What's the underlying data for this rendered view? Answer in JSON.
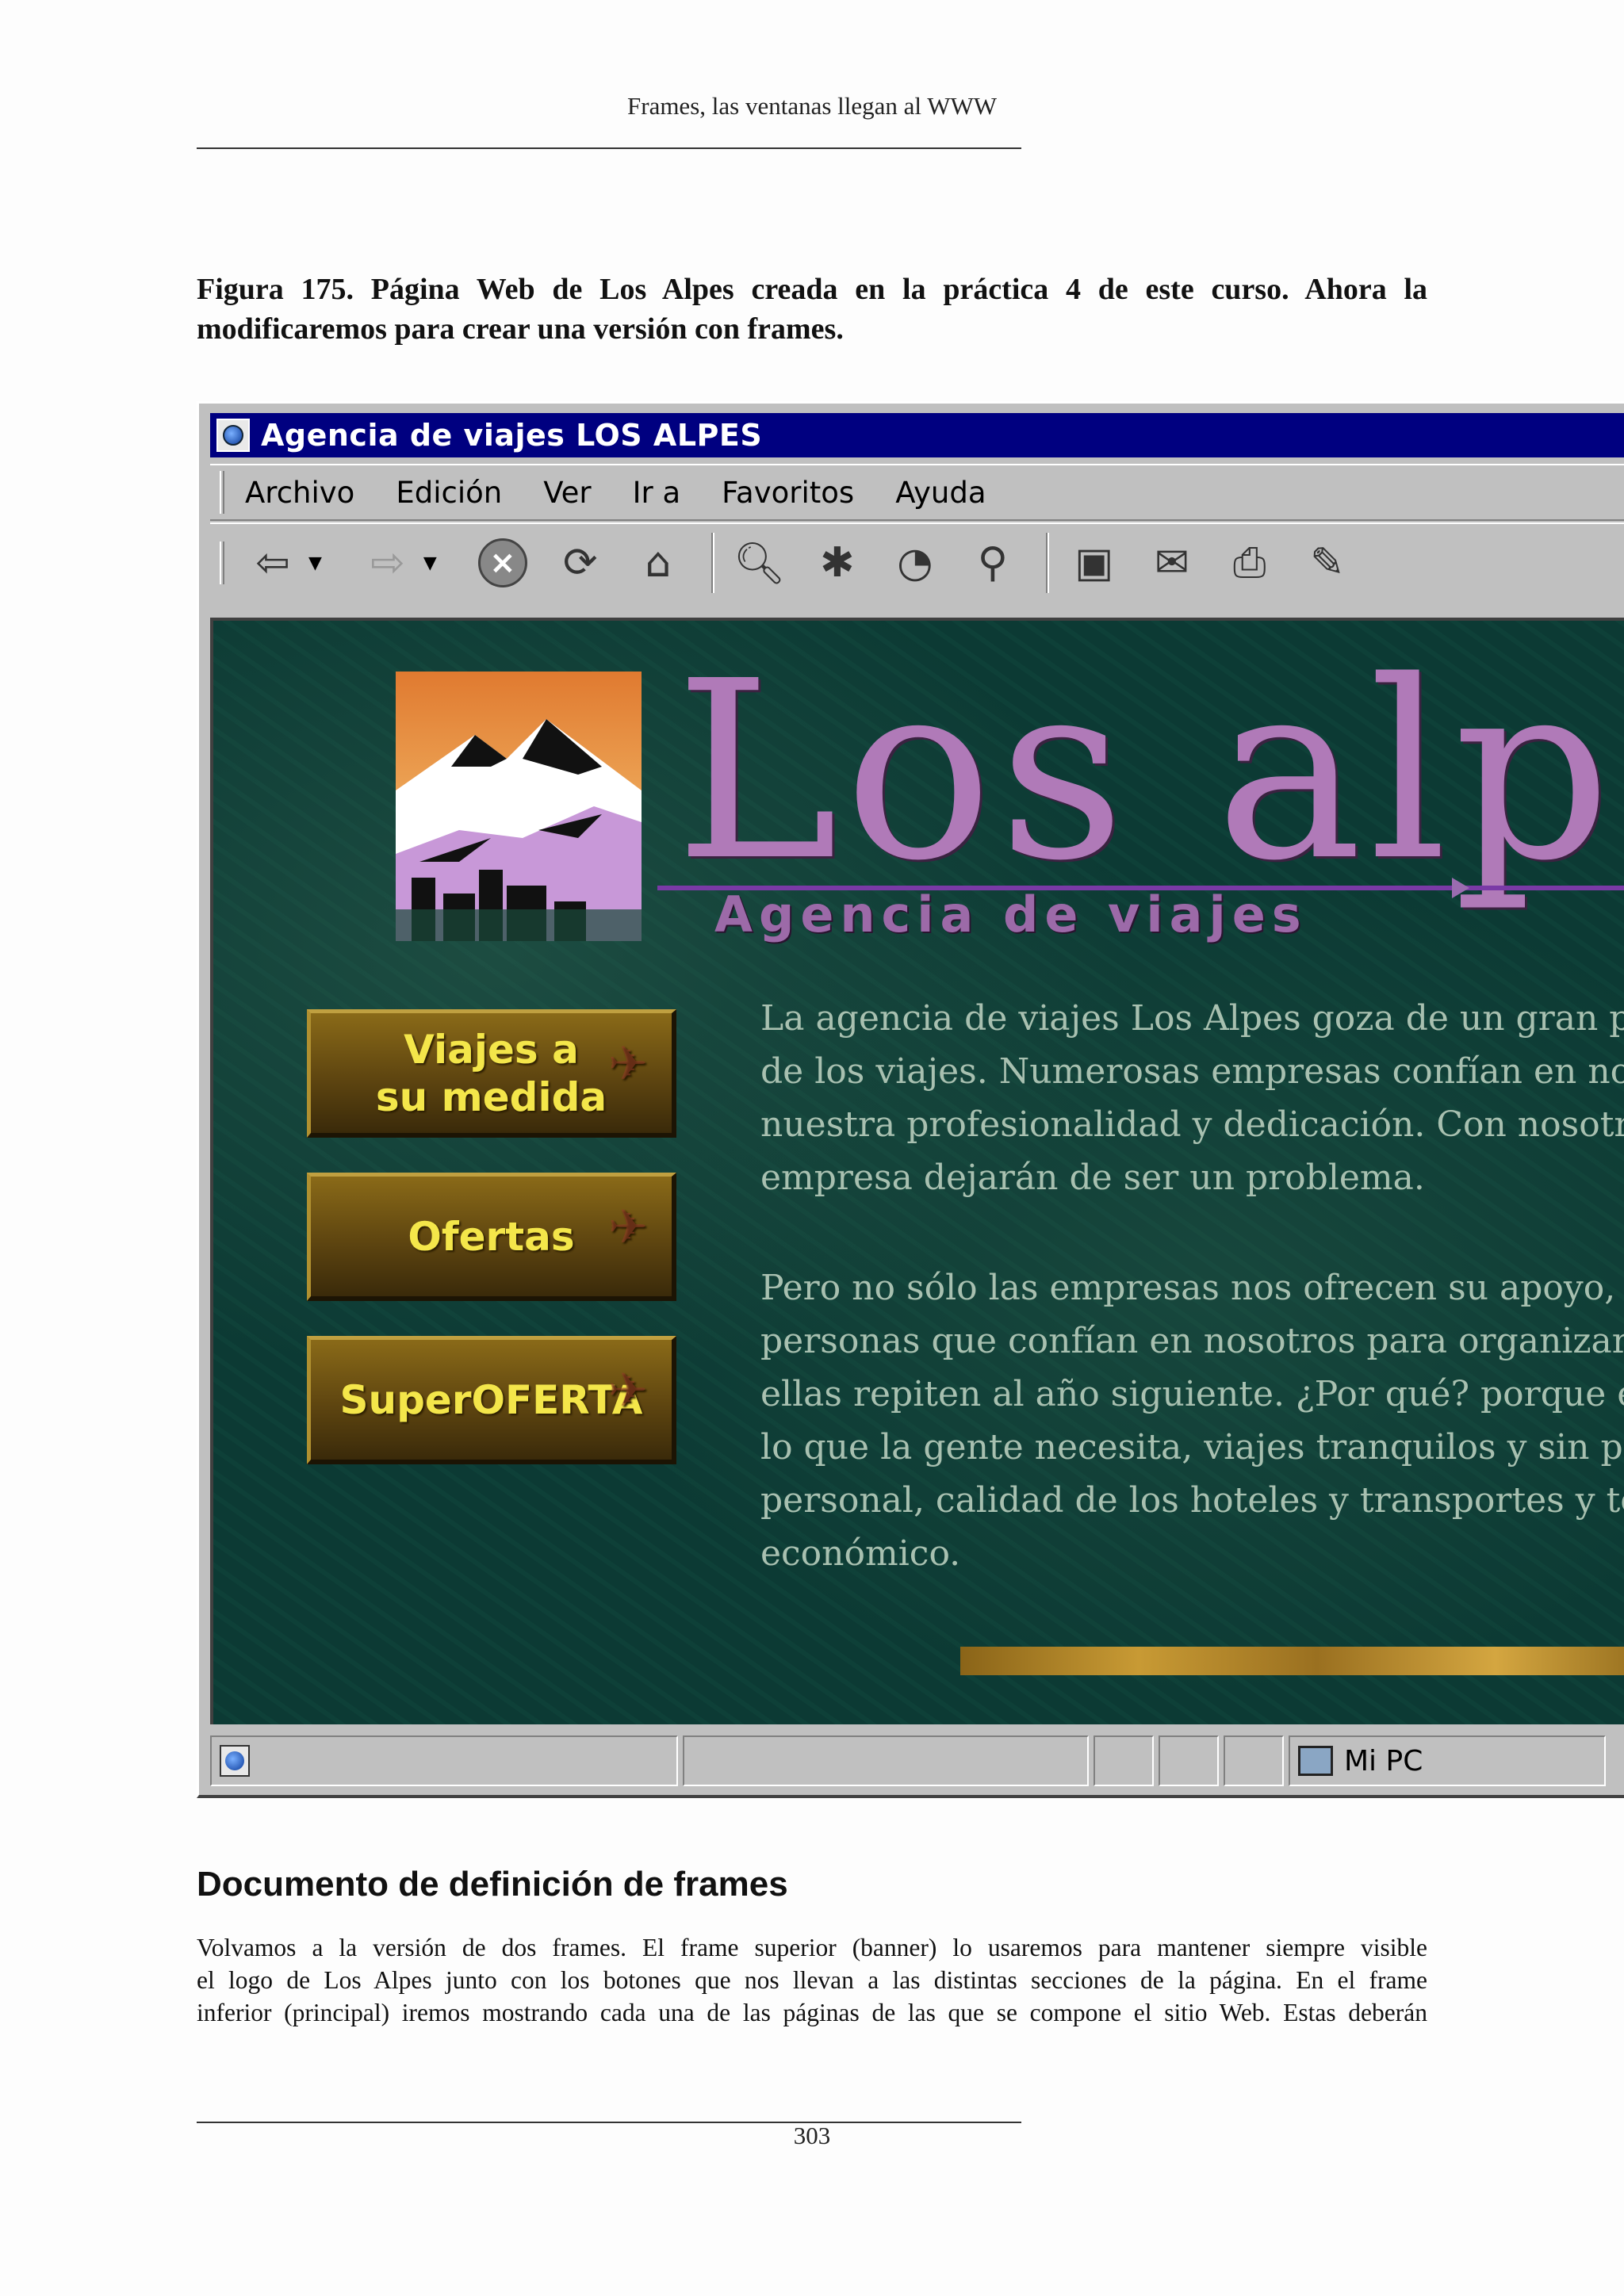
{
  "header": {
    "running_title": "Frames, las ventanas llegan al WWW"
  },
  "figure": {
    "caption": "Figura 175. Página Web de Los Alpes creada en la práctica 4 de este curso. Ahora la modificaremos para crear una versión con frames."
  },
  "browser": {
    "window_title": "Agencia de viajes LOS ALPES",
    "menu": [
      "Archivo",
      "Edición",
      "Ver",
      "Ir a",
      "Favoritos",
      "Ayuda"
    ],
    "toolbar_icons": [
      "back-arrow-icon",
      "forward-arrow-icon",
      "stop-icon",
      "refresh-icon",
      "home-icon",
      "search-icon",
      "favorites-icon",
      "history-icon",
      "channels-icon",
      "fullscreen-icon",
      "mail-icon",
      "print-icon",
      "edit-icon"
    ],
    "status": {
      "zone_label": "Mi PC"
    }
  },
  "site": {
    "brand": "Los alpes",
    "tagline": "Agencia de viajes",
    "nav_buttons": [
      "Viajes a su medida",
      "Ofertas",
      "SuperOFERTA"
    ],
    "paragraph1": [
      "La agencia de viajes Los Alpes goza de un gran pre",
      "de los viajes. Numerosas empresas confían en nosot",
      "nuestra profesionalidad y dedicación. Con nosotros l",
      "empresa dejarán de ser un problema."
    ],
    "paragraph2": [
      "Pero no sólo las empresas nos ofrecen su apoyo, ca",
      "personas que confían en nosotros para organizar sus",
      "ellas repiten al año siguiente. ¿Por qué? porque en L",
      "lo que la gente necesita, viajes tranquilos y sin preocu",
      "personal, calidad de los hoteles y transportes y todo",
      "económico."
    ]
  },
  "section": {
    "title": "Documento de definición de frames",
    "lines": [
      "Volvamos a la versión de dos frames. El frame superior (banner) lo usaremos para mantener siempre visible",
      "el logo de Los Alpes junto con los botones que nos llevan a las distintas secciones de la página. En el frame",
      "inferior (principal) iremos mostrando cada una de las páginas de las que se compone el sitio Web. Estas deberán"
    ]
  },
  "footer": {
    "page_number": "303"
  }
}
